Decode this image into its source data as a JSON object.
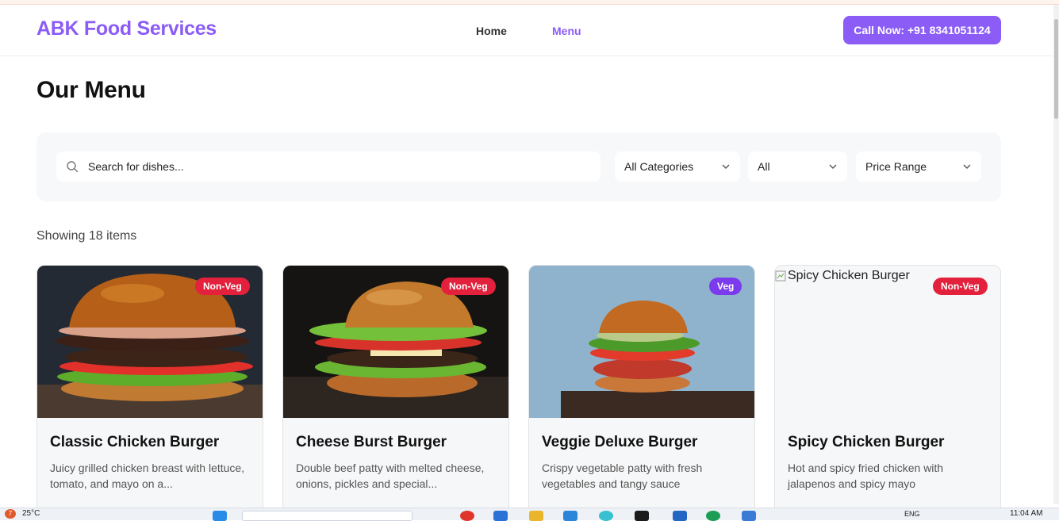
{
  "header": {
    "brand": "ABK Food Services",
    "nav": [
      {
        "label": "Home"
      },
      {
        "label": "Menu"
      }
    ],
    "call_label": "Call Now: +91 8341051124"
  },
  "page_title": "Our Menu",
  "filters": {
    "search_placeholder": "Search for dishes...",
    "category": "All Categories",
    "type": "All",
    "price": "Price Range"
  },
  "showing": "Showing 18 items",
  "cards": [
    {
      "title": "Classic Chicken Burger",
      "badge": "Non-Veg",
      "desc": "Juicy grilled chicken breast with lettuce, tomato, and mayo on a..."
    },
    {
      "title": "Cheese Burst Burger",
      "badge": "Non-Veg",
      "desc": "Double beef patty with melted cheese, onions, pickles and special..."
    },
    {
      "title": "Veggie Deluxe Burger",
      "badge": "Veg",
      "desc": "Crispy vegetable patty with fresh vegetables and tangy sauce"
    },
    {
      "title": "Spicy Chicken Burger",
      "badge": "Non-Veg",
      "desc": "Hot and spicy fried chicken with jalapenos and spicy mayo",
      "image_alt": "Spicy Chicken Burger"
    }
  ],
  "taskbar": {
    "weather": "25°C",
    "lang": "ENG",
    "clock": "11:04 AM",
    "notif_count": "7"
  },
  "colors": {
    "accent": "#8b5cf6",
    "nonveg": "#e3213c",
    "veg": "#7c3aed"
  }
}
